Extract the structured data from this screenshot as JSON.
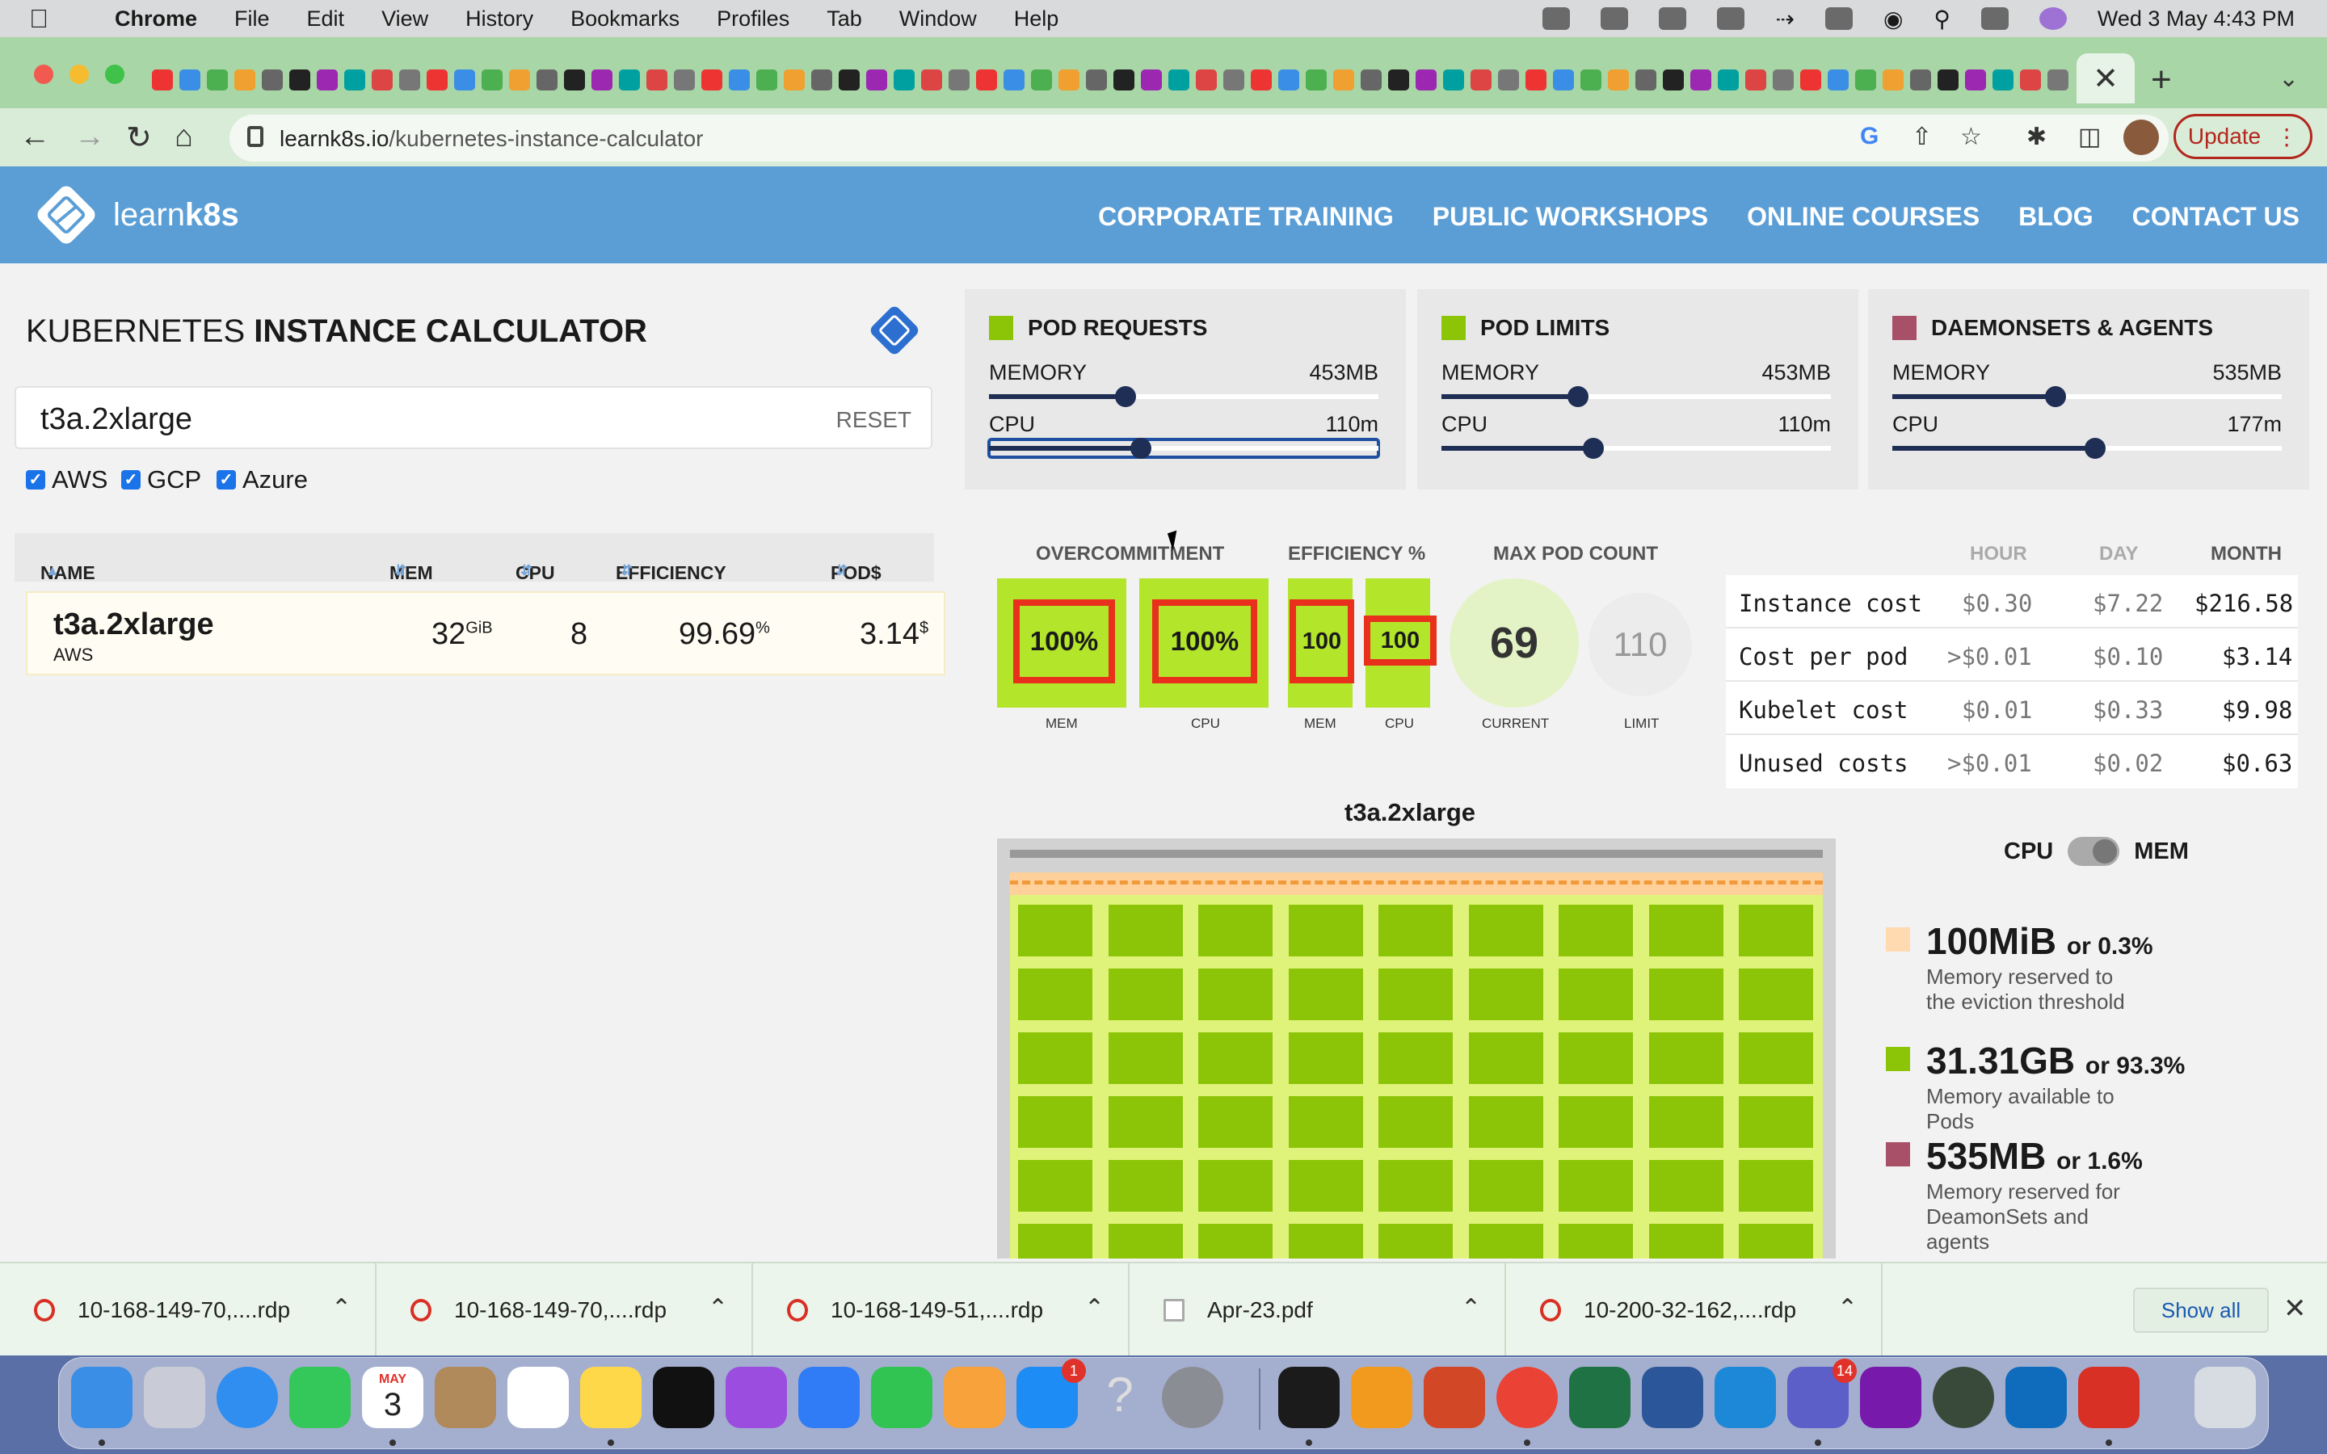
{
  "menubar": {
    "app": "Chrome",
    "items": [
      "File",
      "Edit",
      "View",
      "History",
      "Bookmarks",
      "Profiles",
      "Tab",
      "Window",
      "Help"
    ],
    "clock": "Wed 3 May  4:43 PM"
  },
  "browser": {
    "url_host": "learnk8s.io",
    "url_path": "/kubernetes-instance-calculator",
    "update_label": "Update"
  },
  "site": {
    "logo_light": "learn",
    "logo_bold": "k8s",
    "nav": [
      "CORPORATE TRAINING",
      "PUBLIC WORKSHOPS",
      "ONLINE COURSES",
      "BLOG",
      "CONTACT US"
    ]
  },
  "calculator": {
    "title_light": "KUBERNETES ",
    "title_bold": "INSTANCE CALCULATOR",
    "search_value": "t3a.2xlarge",
    "reset_label": "RESET",
    "providers": [
      "AWS",
      "GCP",
      "Azure"
    ],
    "columns": [
      "NAME",
      "MEM",
      "CPU",
      "EFFICIENCY",
      "POD$"
    ],
    "row": {
      "name": "t3a.2xlarge",
      "provider": "AWS",
      "mem": "32",
      "mem_unit": "GiB",
      "cpu": "8",
      "efficiency": "99.69",
      "efficiency_unit": "%",
      "pod_cost": "3.14",
      "pod_cost_unit": "$"
    }
  },
  "cards": {
    "pod_requests": {
      "title": "POD REQUESTS",
      "color": "#8cc408",
      "memory_label": "MEMORY",
      "memory_value": "453MB",
      "memory_fraction": 0.35,
      "cpu_label": "CPU",
      "cpu_value": "110m",
      "cpu_fraction": 0.39
    },
    "pod_limits": {
      "title": "POD LIMITS",
      "color": "#8cc408",
      "memory_label": "MEMORY",
      "memory_value": "453MB",
      "memory_fraction": 0.35,
      "cpu_label": "CPU",
      "cpu_value": "110m",
      "cpu_fraction": 0.39
    },
    "daemonsets": {
      "title": "DAEMONSETS & AGENTS",
      "color": "#a85068",
      "memory_label": "MEMORY",
      "memory_value": "535MB",
      "memory_fraction": 0.42,
      "cpu_label": "CPU",
      "cpu_value": "177m",
      "cpu_fraction": 0.52
    }
  },
  "stats": {
    "overcommitment_title": "OVERCOMMITMENT",
    "overcommit_mem": "100%",
    "overcommit_mem_label": "MEM",
    "overcommit_cpu": "100%",
    "overcommit_cpu_label": "CPU",
    "efficiency_title": "EFFICIENCY %",
    "efficiency_mem": "100",
    "efficiency_mem_label": "MEM",
    "efficiency_cpu": "100",
    "efficiency_cpu_label": "CPU",
    "maxpod_title": "MAX POD COUNT",
    "current": "69",
    "current_label": "CURRENT",
    "limit": "110",
    "limit_label": "LIMIT"
  },
  "costs": {
    "headers": [
      "HOUR",
      "DAY",
      "MONTH"
    ],
    "rows": [
      {
        "label": "Instance cost",
        "hour": "$0.30",
        "day": "$7.22",
        "month": "$216.58"
      },
      {
        "label": "Cost per pod",
        "hour": ">$0.01",
        "day": "$0.10",
        "month": "$3.14"
      },
      {
        "label": "Kubelet cost",
        "hour": "$0.01",
        "day": "$0.33",
        "month": "$9.98"
      },
      {
        "label": "Unused costs",
        "hour": ">$0.01",
        "day": "$0.02",
        "month": "$0.63"
      }
    ]
  },
  "visual": {
    "title": "t3a.2xlarge",
    "toggle_left": "CPU",
    "toggle_right": "MEM",
    "legend": [
      {
        "value": "100MiB",
        "pct": "or 0.3%",
        "desc": "Memory reserved to the eviction threshold",
        "color": "#ffd9b0"
      },
      {
        "value": "31.31GB",
        "pct": "or 93.3%",
        "desc": "Memory available to Pods",
        "color": "#8cc408"
      },
      {
        "value": "535MB",
        "pct": "or 1.6%",
        "desc": "Memory reserved for DeamonSets and agents",
        "color": "#a85068"
      }
    ]
  },
  "downloads": {
    "files": [
      "10-168-149-70,....rdp",
      "10-168-149-70,....rdp",
      "10-168-149-51,....rdp",
      "Apr-23.pdf",
      "10-200-32-162,....rdp"
    ],
    "show_all": "Show all"
  },
  "dock": {
    "calendar_month": "MAY",
    "calendar_day": "3",
    "appstore_badge": "1",
    "teams_badge": "14"
  }
}
